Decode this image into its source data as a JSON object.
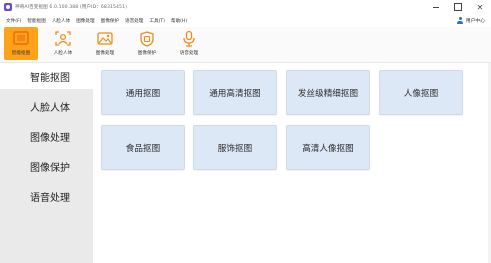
{
  "window": {
    "title": "神奇AI百变抠图 6.0.100.388 (用户ID：68315451)"
  },
  "menubar": {
    "items": [
      "文件(F)",
      "智能抠图",
      "人脸人体",
      "图像处理",
      "图像保护",
      "语音处理",
      "工具(T)",
      "帮助(H)"
    ],
    "user_center": "用户中心"
  },
  "toolbar": {
    "tools": [
      {
        "label": "智能抠图",
        "icon": "smart-matting-icon"
      },
      {
        "label": "人脸人体",
        "icon": "face-body-icon"
      },
      {
        "label": "图像处理",
        "icon": "image-processing-icon"
      },
      {
        "label": "图像保护",
        "icon": "image-protect-icon"
      },
      {
        "label": "语音处理",
        "icon": "voice-processing-icon"
      }
    ],
    "active_index": 0,
    "active_color": "#ffa21a",
    "icon_color": "#f08a1c"
  },
  "sidebar": {
    "items": [
      {
        "label": "智能抠图"
      },
      {
        "label": "人脸人体"
      },
      {
        "label": "图像处理"
      },
      {
        "label": "图像保护"
      },
      {
        "label": "语音处理"
      }
    ],
    "active_index": 0
  },
  "main": {
    "cards": [
      {
        "label": "通用抠图"
      },
      {
        "label": "通用高清抠图"
      },
      {
        "label": "发丝级精细抠图"
      },
      {
        "label": "人像抠图"
      },
      {
        "label": "食品抠图"
      },
      {
        "label": "服饰抠图"
      },
      {
        "label": "高清人像抠图"
      }
    ]
  }
}
